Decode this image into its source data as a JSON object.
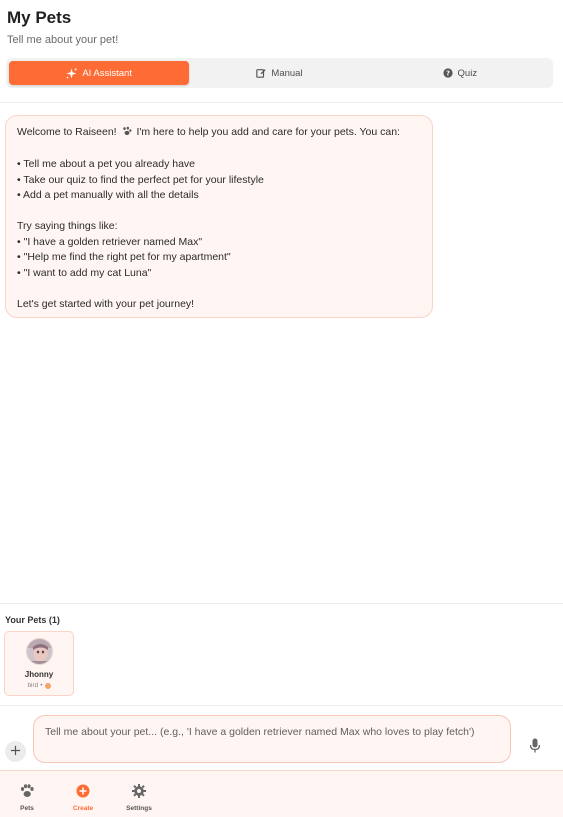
{
  "header": {
    "title": "My Pets",
    "subtitle": "Tell me about your pet!"
  },
  "tabs": [
    {
      "label": "AI Assistant",
      "icon": "sparkles-icon",
      "active": true
    },
    {
      "label": "Manual",
      "icon": "edit-icon",
      "active": false
    },
    {
      "label": "Quiz",
      "icon": "question-circle-icon",
      "active": false
    }
  ],
  "chat": {
    "message": {
      "line1_before": "Welcome to Raiseen!",
      "line1_icon": "paw-icon",
      "line1_after": "I'm here to help you add and care for your pets. You can:",
      "bullets": [
        "• Tell me about a pet you already have",
        "• Take our quiz to find the perfect pet for your lifestyle",
        "• Add a pet manually with all the details"
      ],
      "examples_heading": "Try saying things like:",
      "examples": [
        "• \"I have a golden retriever named Max\"",
        "• \"Help me find the right pet for my apartment\"",
        "• \"I want to add my cat Luna\""
      ],
      "closing": "Let's get started with your pet journey!"
    }
  },
  "pets": {
    "heading": "Your Pets (1)",
    "items": [
      {
        "name": "Jhonny",
        "type": "bird",
        "separator": "•"
      }
    ]
  },
  "input": {
    "placeholder": "Tell me about your pet... (e.g., 'I have a golden retriever named Max who loves to play fetch')"
  },
  "nav": [
    {
      "label": "Pets",
      "icon": "paw-icon",
      "active": false
    },
    {
      "label": "Create",
      "icon": "plus-circle-icon",
      "active": true
    },
    {
      "label": "Settings",
      "icon": "gear-icon",
      "active": false
    }
  ],
  "colors": {
    "accent": "#ff6b35",
    "bubble_bg": "#fff5f2",
    "bubble_border": "#fbd3c7"
  }
}
